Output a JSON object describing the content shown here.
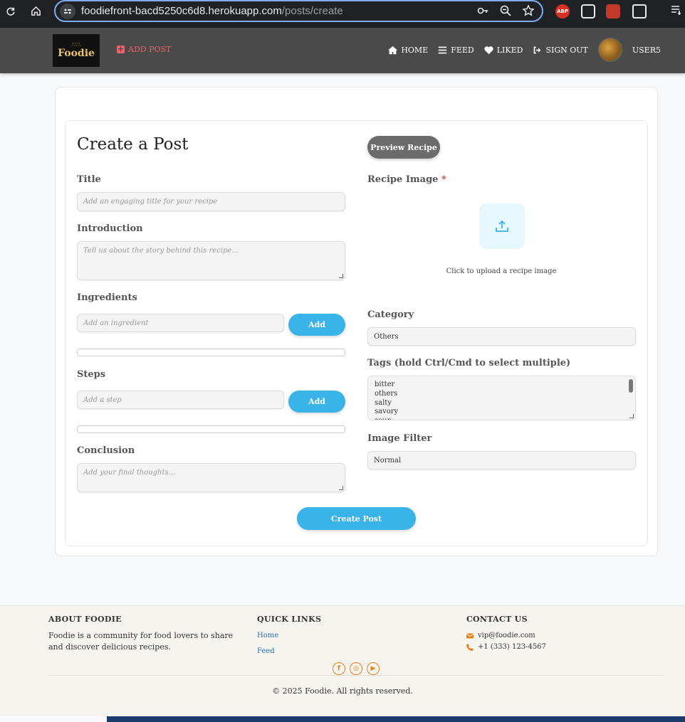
{
  "browser": {
    "url_host": "foodiefront-bacd5250c6d8.herokuapp.com",
    "url_path": "/posts/create",
    "extensions": [
      "ABP"
    ]
  },
  "header": {
    "logo_text": "Foodie",
    "add_post": "ADD POST",
    "nav": [
      {
        "label": "HOME",
        "icon": "home-icon"
      },
      {
        "label": "FEED",
        "icon": "list-icon"
      },
      {
        "label": "LIKED",
        "icon": "heart-icon"
      },
      {
        "label": "SIGN OUT",
        "icon": "sign-out-icon"
      }
    ],
    "username": "USER5",
    "accent_color": "#e7656a"
  },
  "form": {
    "title": "Create a Post",
    "preview_button": "Preview Recipe",
    "title_label": "Title",
    "title_placeholder": "Add an engaging title for your recipe",
    "intro_label": "Introduction",
    "intro_placeholder": "Tell us about the story behind this recipe...",
    "ingredients_label": "Ingredients",
    "ingredient_placeholder": "Add an ingredient",
    "add_button": "Add",
    "steps_label": "Steps",
    "step_placeholder": "Add a step",
    "conclusion_label": "Conclusion",
    "conclusion_placeholder": "Add your final thoughts...",
    "image_label": "Recipe Image",
    "required_mark": "*",
    "upload_text": "Click to upload a recipe image",
    "category_label": "Category",
    "category_value": "Others",
    "tags_label": "Tags (hold Ctrl/Cmd to select multiple)",
    "tags_options": [
      "bitter",
      "others",
      "salty",
      "savory",
      "sour"
    ],
    "filter_label": "Image Filter",
    "filter_value": "Normal",
    "create_button": "Create Post",
    "button_color": "#3ab3e8"
  },
  "footer": {
    "about_heading": "ABOUT FOODIE",
    "about_text": "Foodie is a community for food lovers to share and discover delicious recipes.",
    "links_heading": "QUICK LINKS",
    "links": [
      "Home",
      "Feed"
    ],
    "contact_heading": "CONTACT US",
    "email": "vip@foodie.com",
    "phone": "+1 (333) 123-4567",
    "socials": [
      "facebook-icon",
      "instagram-icon",
      "youtube-icon"
    ],
    "copyright": "© 2025 Foodie. All rights reserved."
  }
}
